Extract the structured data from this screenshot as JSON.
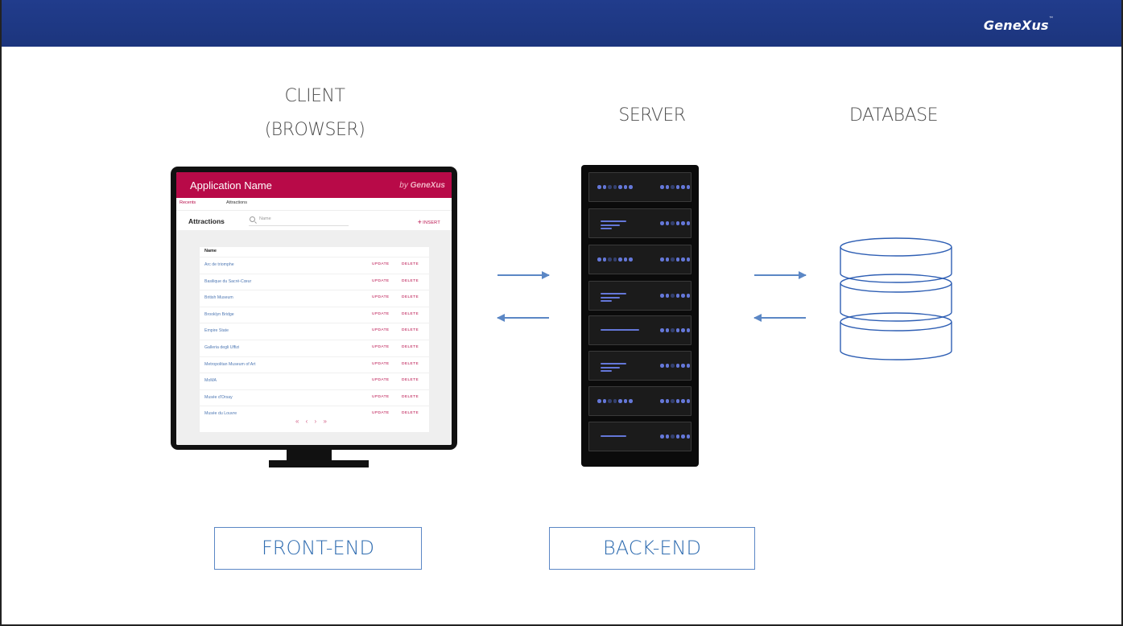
{
  "brand": {
    "name": "GeneXus",
    "tm": "™"
  },
  "headings": {
    "client_line1": "CLIENT",
    "client_line2": "(BROWSER)",
    "server": "SERVER",
    "database": "DATABASE"
  },
  "app": {
    "title": "Application Name",
    "by_prefix": "by",
    "by_brand": "GeneXus",
    "tabs": [
      "Recents",
      "Attractions"
    ],
    "toolbar_title": "Attractions",
    "search_placeholder": "Name",
    "insert_label": "INSERT",
    "grid_header": "Name",
    "update_label": "UPDATE",
    "delete_label": "DELETE",
    "rows": [
      "Arc de triomphe",
      "Basilique du Sacré-Cœur",
      "British Museum",
      "Brooklyn Bridge",
      "Empire State",
      "Galleria degli Uffizi",
      "Metropolitan Museum of Art",
      "MoMA",
      "Musée d'Orsay",
      "Musée du Louvre"
    ],
    "pager": "« ‹ › »"
  },
  "labels": {
    "front_end": "FRONT-END",
    "back_end": "BACK-END"
  },
  "colors": {
    "topbar": "#1f3a8a",
    "app_header": "#b80a48",
    "arrow": "#5b87c5",
    "label_text": "#2f6cb0",
    "server_led": "#6477d8",
    "database": "#2f5fb4"
  }
}
